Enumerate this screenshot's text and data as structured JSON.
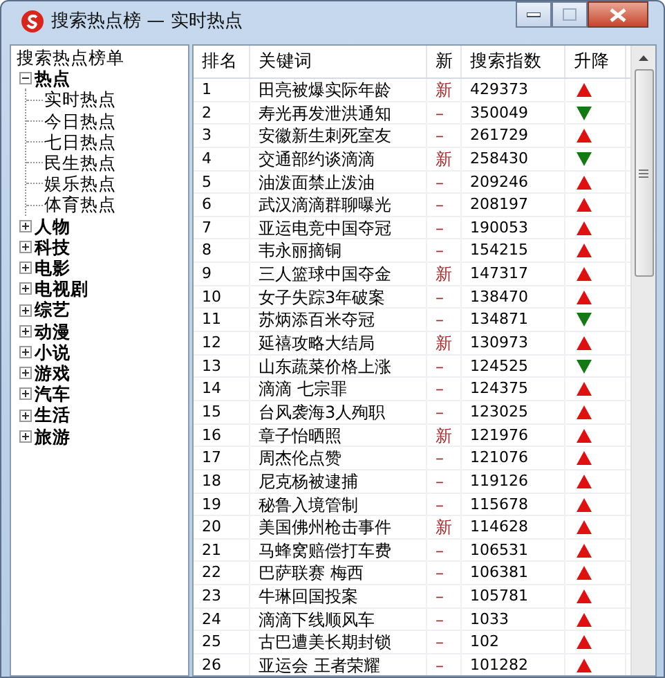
{
  "window": {
    "title": "搜索热点榜 — 实时热点"
  },
  "tree": {
    "label": "搜索热点榜单",
    "children": [
      {
        "label": "热点",
        "expanded": true,
        "children": [
          {
            "label": "实时热点"
          },
          {
            "label": "今日热点"
          },
          {
            "label": "七日热点"
          },
          {
            "label": "民生热点"
          },
          {
            "label": "娱乐热点"
          },
          {
            "label": "体育热点"
          }
        ]
      },
      {
        "label": "人物",
        "expanded": false
      },
      {
        "label": "科技",
        "expanded": false
      },
      {
        "label": "电影",
        "expanded": false
      },
      {
        "label": "电视剧",
        "expanded": false
      },
      {
        "label": "综艺",
        "expanded": false
      },
      {
        "label": "动漫",
        "expanded": false
      },
      {
        "label": "小说",
        "expanded": false
      },
      {
        "label": "游戏",
        "expanded": false
      },
      {
        "label": "汽车",
        "expanded": false
      },
      {
        "label": "生活",
        "expanded": false
      },
      {
        "label": "旅游",
        "expanded": false
      }
    ]
  },
  "table": {
    "columns": [
      "排名",
      "关键词",
      "新",
      "搜索指数",
      "升降"
    ],
    "rows": [
      {
        "rank": "1",
        "keyword": "田亮被爆实际年龄",
        "new": "新",
        "index": "429373",
        "rising": true
      },
      {
        "rank": "2",
        "keyword": "寿光再发泄洪通知",
        "new": "–",
        "index": "350049",
        "rising": false
      },
      {
        "rank": "3",
        "keyword": "安徽新生刺死室友",
        "new": "–",
        "index": "261729",
        "rising": true
      },
      {
        "rank": "4",
        "keyword": "交通部约谈滴滴",
        "new": "新",
        "index": "258430",
        "rising": false
      },
      {
        "rank": "5",
        "keyword": "油泼面禁止泼油",
        "new": "–",
        "index": "209246",
        "rising": true
      },
      {
        "rank": "6",
        "keyword": "武汉滴滴群聊曝光",
        "new": "–",
        "index": "208197",
        "rising": true
      },
      {
        "rank": "7",
        "keyword": "亚运电竞中国夺冠",
        "new": "–",
        "index": "190053",
        "rising": true
      },
      {
        "rank": "8",
        "keyword": "韦永丽摘铜",
        "new": "–",
        "index": "154215",
        "rising": true
      },
      {
        "rank": "9",
        "keyword": "三人篮球中国夺金",
        "new": "新",
        "index": "147317",
        "rising": true
      },
      {
        "rank": "10",
        "keyword": "女子失踪3年破案",
        "new": "–",
        "index": "138470",
        "rising": true
      },
      {
        "rank": "11",
        "keyword": "苏炳添百米夺冠",
        "new": "–",
        "index": "134871",
        "rising": false
      },
      {
        "rank": "12",
        "keyword": "延禧攻略大结局",
        "new": "新",
        "index": "130973",
        "rising": true
      },
      {
        "rank": "13",
        "keyword": "山东蔬菜价格上涨",
        "new": "–",
        "index": "124525",
        "rising": false
      },
      {
        "rank": "14",
        "keyword": "滴滴 七宗罪",
        "new": "–",
        "index": "124375",
        "rising": true
      },
      {
        "rank": "15",
        "keyword": "台风袭海3人殉职",
        "new": "–",
        "index": "123025",
        "rising": true
      },
      {
        "rank": "16",
        "keyword": "章子怡晒照",
        "new": "新",
        "index": "121976",
        "rising": true
      },
      {
        "rank": "17",
        "keyword": "周杰伦点赞",
        "new": "–",
        "index": "121076",
        "rising": true
      },
      {
        "rank": "18",
        "keyword": "尼克杨被逮捕",
        "new": "–",
        "index": "119126",
        "rising": true
      },
      {
        "rank": "19",
        "keyword": "秘鲁入境管制",
        "new": "–",
        "index": "115678",
        "rising": true
      },
      {
        "rank": "20",
        "keyword": "美国佛州枪击事件",
        "new": "新",
        "index": "114628",
        "rising": true
      },
      {
        "rank": "21",
        "keyword": "马蜂窝赔偿打车费",
        "new": "–",
        "index": "106531",
        "rising": true
      },
      {
        "rank": "22",
        "keyword": "巴萨联赛 梅西",
        "new": "–",
        "index": "106381",
        "rising": true
      },
      {
        "rank": "23",
        "keyword": "牛琳回国投案",
        "new": "–",
        "index": "105781",
        "rising": true
      },
      {
        "rank": "24",
        "keyword": "滴滴下线顺风车",
        "new": "–",
        "index": "1033",
        "rising": true
      },
      {
        "rank": "25",
        "keyword": "古巴遭美长期封锁",
        "new": "–",
        "index": "102",
        "rising": true
      },
      {
        "rank": "26",
        "keyword": "亚运会 王者荣耀",
        "new": "–",
        "index": "101282",
        "rising": true
      }
    ]
  }
}
